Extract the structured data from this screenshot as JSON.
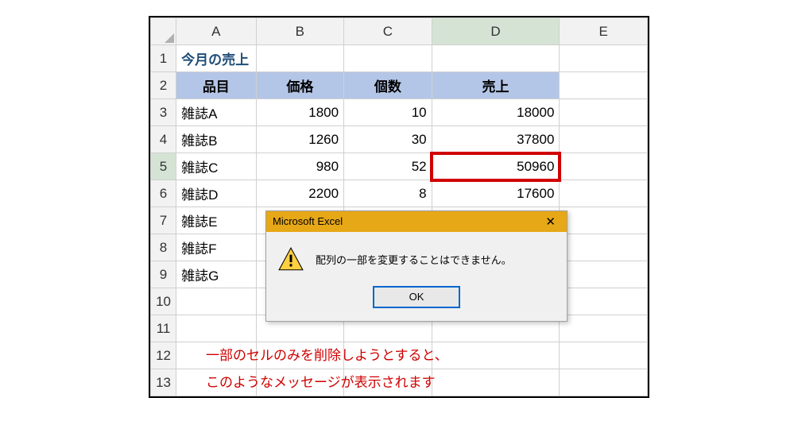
{
  "columns": [
    "A",
    "B",
    "C",
    "D",
    "E"
  ],
  "title_cell": "今月の売上",
  "header_row": {
    "item": "品目",
    "price": "価格",
    "qty": "個数",
    "sales": "売上"
  },
  "rows": [
    {
      "n": 3,
      "item": "雑誌A",
      "price": "1800",
      "qty": "10",
      "sales": "18000"
    },
    {
      "n": 4,
      "item": "雑誌B",
      "price": "1260",
      "qty": "30",
      "sales": "37800"
    },
    {
      "n": 5,
      "item": "雑誌C",
      "price": "980",
      "qty": "52",
      "sales": "50960"
    },
    {
      "n": 6,
      "item": "雑誌D",
      "price": "2200",
      "qty": "8",
      "sales": "17600"
    },
    {
      "n": 7,
      "item": "雑誌E",
      "price": "",
      "qty": "",
      "sales": ""
    },
    {
      "n": 8,
      "item": "雑誌F",
      "price": "",
      "qty": "",
      "sales": ""
    },
    {
      "n": 9,
      "item": "雑誌G",
      "price": "",
      "qty": "",
      "sales": ""
    }
  ],
  "blank_rows": [
    10,
    11,
    12,
    13
  ],
  "selected_cell": "D5",
  "dialog": {
    "title": "Microsoft Excel",
    "message": "配列の一部を変更することはできません。",
    "ok": "OK"
  },
  "annotation": {
    "line1": "一部のセルのみを削除しようとすると、",
    "line2": "このようなメッセージが表示されます"
  },
  "chart_data": {
    "type": "table",
    "title": "今月の売上",
    "columns": [
      "品目",
      "価格",
      "個数",
      "売上"
    ],
    "rows": [
      [
        "雑誌A",
        1800,
        10,
        18000
      ],
      [
        "雑誌B",
        1260,
        30,
        37800
      ],
      [
        "雑誌C",
        980,
        52,
        50960
      ],
      [
        "雑誌D",
        2200,
        8,
        17600
      ],
      [
        "雑誌E",
        null,
        null,
        null
      ],
      [
        "雑誌F",
        null,
        null,
        null
      ],
      [
        "雑誌G",
        null,
        null,
        null
      ]
    ]
  }
}
